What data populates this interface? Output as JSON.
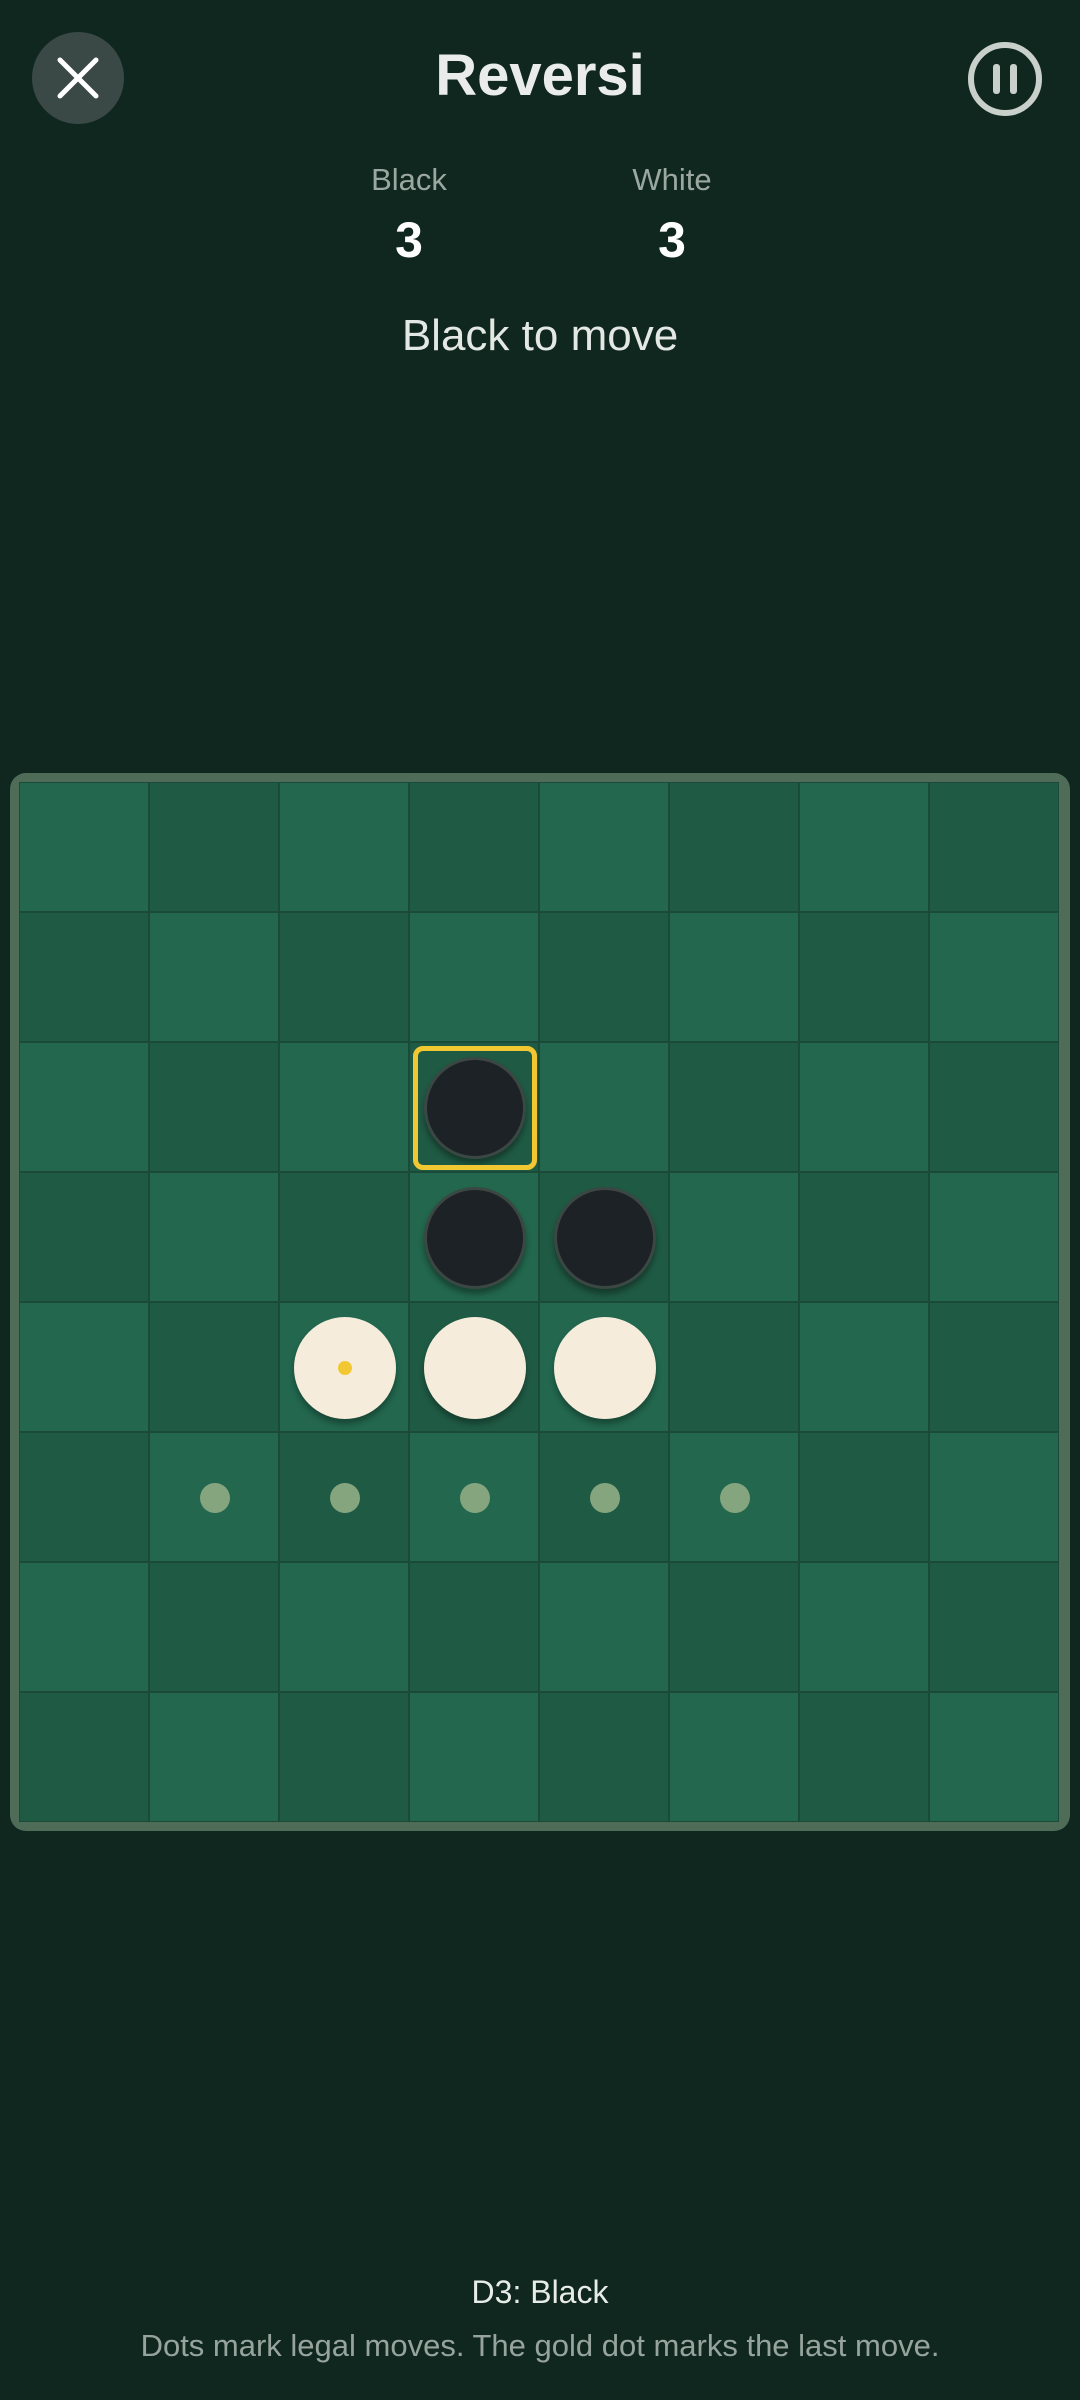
{
  "header": {
    "title": "Reversi",
    "close_icon": "close-icon",
    "pause_icon": "pause-icon"
  },
  "score": {
    "black_label": "Black",
    "black_value": "3",
    "white_label": "White",
    "white_value": "3"
  },
  "status": "Black to move",
  "board": {
    "size": 8,
    "pieces": [
      {
        "row": 2,
        "col": 3,
        "color": "black"
      },
      {
        "row": 3,
        "col": 3,
        "color": "black"
      },
      {
        "row": 3,
        "col": 4,
        "color": "black"
      },
      {
        "row": 4,
        "col": 2,
        "color": "white"
      },
      {
        "row": 4,
        "col": 3,
        "color": "white"
      },
      {
        "row": 4,
        "col": 4,
        "color": "white"
      }
    ],
    "legal_moves": [
      {
        "row": 5,
        "col": 1
      },
      {
        "row": 5,
        "col": 2
      },
      {
        "row": 5,
        "col": 3
      },
      {
        "row": 5,
        "col": 4
      },
      {
        "row": 5,
        "col": 5
      }
    ],
    "last_move_dot": {
      "row": 4,
      "col": 2
    },
    "highlighted_cell": {
      "row": 2,
      "col": 3
    }
  },
  "colors": {
    "highlight": "#f2c832",
    "last_move_dot": "#f2c832"
  },
  "footer": {
    "last_move": "D3: Black",
    "hint": "Dots mark legal moves. The gold dot marks the last move."
  }
}
